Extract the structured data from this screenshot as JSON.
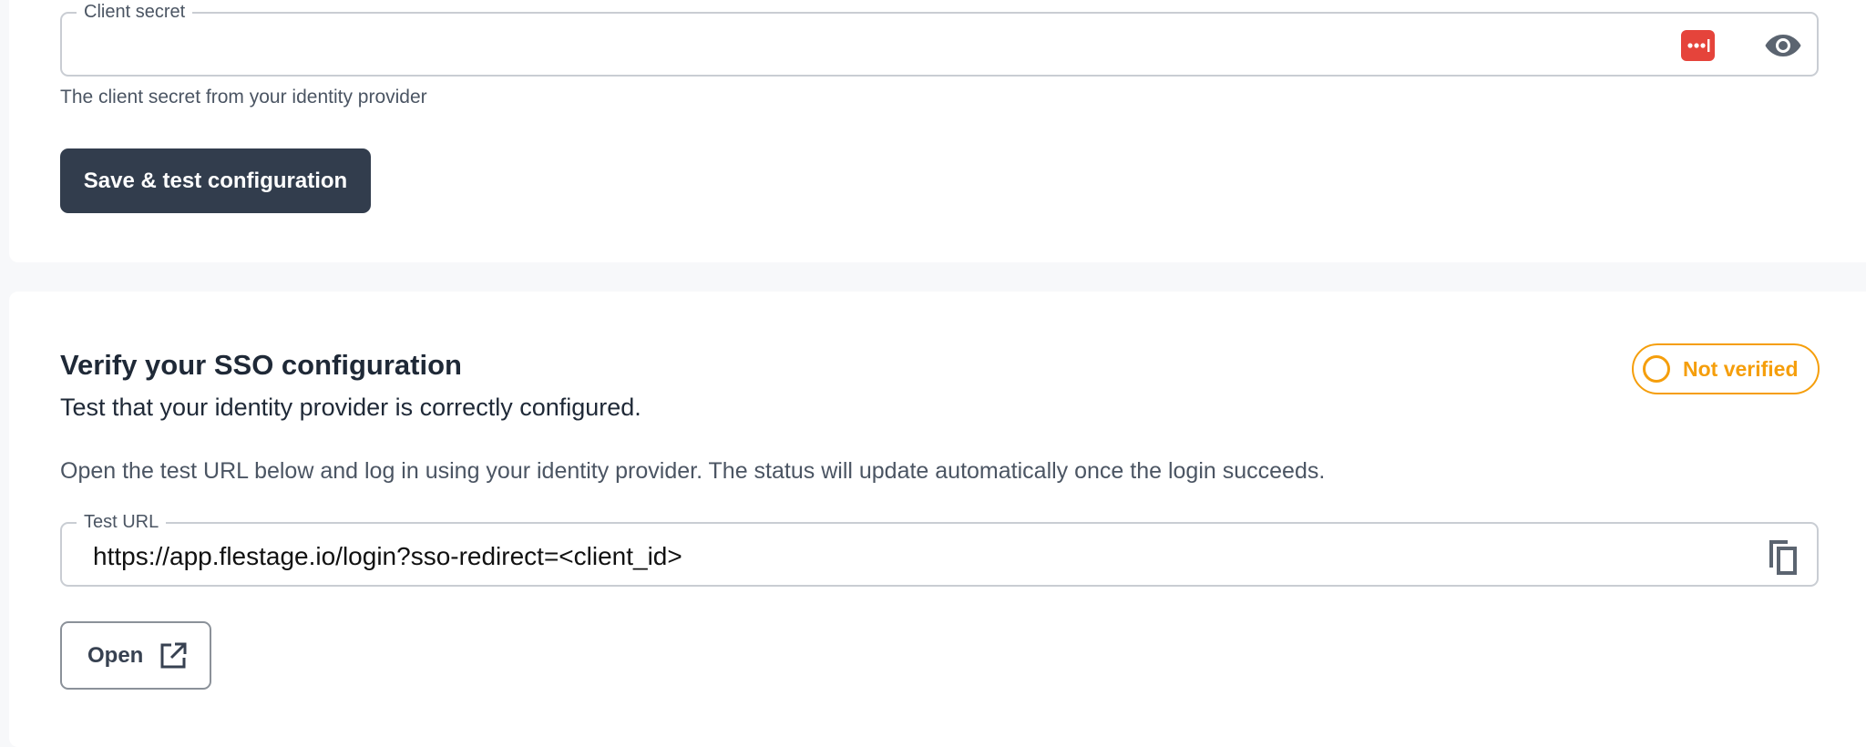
{
  "client_secret": {
    "legend": "Client secret",
    "value": "",
    "helper": "The client secret from your identity provider",
    "icons": [
      "password-manager-icon",
      "eye-icon"
    ]
  },
  "save_button": {
    "label": "Save & test configuration"
  },
  "verify": {
    "title": "Verify your SSO configuration",
    "subtitle": "Test that your identity provider is correctly configured.",
    "description": "Open the test URL below and log in using your identity provider. The status will update automatically once the login succeeds.",
    "status": {
      "label": "Not verified",
      "color": "#f59e0b",
      "icon": "empty-circle-icon"
    },
    "test_url": {
      "legend": "Test URL",
      "value": "https://app.flestage.io/login?sso-redirect=<client_id>",
      "icon": "copy-icon"
    },
    "open_button": {
      "label": "Open",
      "icon": "external-link-icon"
    }
  },
  "colors": {
    "primary_button": "#323d4d",
    "password_manager": "#e5443b",
    "warning": "#f59e0b"
  }
}
